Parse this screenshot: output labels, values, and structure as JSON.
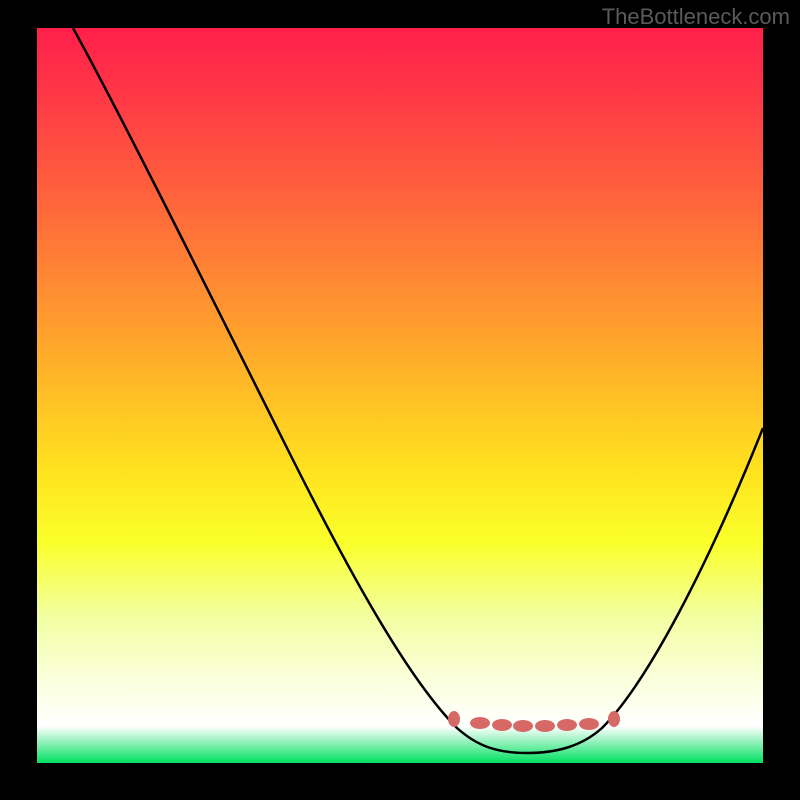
{
  "watermark": "TheBottleneck.com",
  "chart_data": {
    "type": "line",
    "title": "",
    "xlabel": "",
    "ylabel": "",
    "xlim": [
      0,
      100
    ],
    "ylim": [
      0,
      100
    ],
    "background_gradient": {
      "top": "#ff1f4a",
      "mid": "#fff020",
      "bottom": "#00e060"
    },
    "series": [
      {
        "name": "curve",
        "x": [
          5,
          10,
          20,
          30,
          40,
          50,
          56,
          60,
          64,
          68,
          72,
          76,
          80,
          85,
          90,
          95,
          100
        ],
        "y": [
          100,
          92,
          77,
          62,
          47,
          32,
          20,
          12,
          6,
          2,
          1,
          2,
          6,
          14,
          24,
          35,
          46
        ]
      }
    ],
    "markers": {
      "y": 4,
      "x_positions": [
        57,
        60,
        63,
        66,
        69,
        72,
        75,
        78,
        81
      ]
    },
    "colors": {
      "curve": "#000000",
      "markers": "#d66966"
    }
  }
}
